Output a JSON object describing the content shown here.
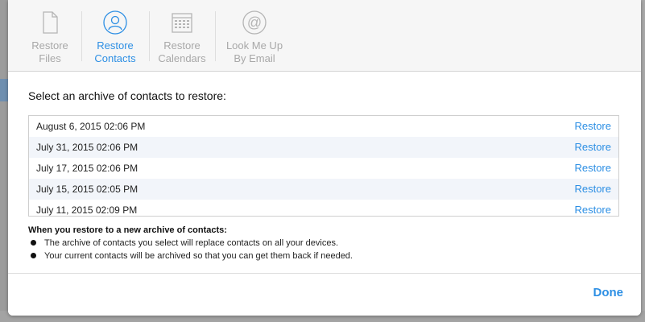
{
  "tabs": [
    {
      "line1": "Restore",
      "line2": "Files",
      "icon": "document-icon",
      "active": false
    },
    {
      "line1": "Restore",
      "line2": "Contacts",
      "icon": "contacts-icon",
      "active": true
    },
    {
      "line1": "Restore",
      "line2": "Calendars",
      "icon": "calendar-icon",
      "active": false
    },
    {
      "line1": "Look Me Up",
      "line2": "By Email",
      "icon": "at-sign-icon",
      "active": false
    }
  ],
  "heading": "Select an archive of contacts to restore:",
  "archives": [
    {
      "date": "August 6, 2015 02:06 PM",
      "action": "Restore"
    },
    {
      "date": "July 31, 2015 02:06 PM",
      "action": "Restore"
    },
    {
      "date": "July 17, 2015 02:06 PM",
      "action": "Restore"
    },
    {
      "date": "July 15, 2015 02:05 PM",
      "action": "Restore"
    },
    {
      "date": "July 11, 2015 02:09 PM",
      "action": "Restore"
    }
  ],
  "note": {
    "title": "When you restore to a new archive of contacts:",
    "items": [
      "The archive of contacts you select will replace contacts on all your devices.",
      "Your current contacts will be archived so that you can get them back if needed."
    ]
  },
  "footer": {
    "done_label": "Done"
  },
  "colors": {
    "accent": "#2d8fe4",
    "inactive": "#a8a8a8"
  }
}
